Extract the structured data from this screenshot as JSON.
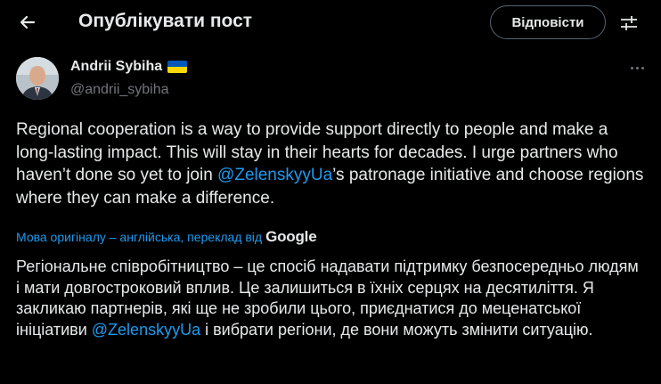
{
  "header": {
    "title": "Опублікувати пост",
    "reply_label": "Відповісти"
  },
  "author": {
    "name": "Andrii Sybiha",
    "handle": "@andrii_sybiha"
  },
  "post": {
    "text_before": "Regional cooperation is a way to provide support directly to people and make a long-lasting impact. This will stay in their hearts for decades. I urge partners who haven’t done so yet to join ",
    "mention": "@ZelenskyyUa",
    "text_after": "’s patronage initiative and choose regions where they can make a difference."
  },
  "translation": {
    "note": "Мова оригіналу – англійська, переклад від",
    "provider": "Google",
    "text_before": "Регіональне співробітництво – це спосіб надавати підтримку безпосередньо людям і мати довгостроковий вплив. Це залишиться в їхніх серцях на десятиліття. Я закликаю партнерів, які ще не зробили цього, приєднатися до меценатської ініціативи ",
    "mention": "@ZelenskyyUa",
    "text_after": " і вибрати регіони, де вони можуть змінити ситуацію."
  },
  "colors": {
    "background": "#000000",
    "text": "#e7e9ea",
    "muted": "#71767b",
    "accent": "#1d9bf0"
  },
  "icons": [
    "back-arrow-icon",
    "settings-sliders-icon",
    "ukraine-flag-icon",
    "more-dots-icon",
    "google-logo-icon"
  ]
}
